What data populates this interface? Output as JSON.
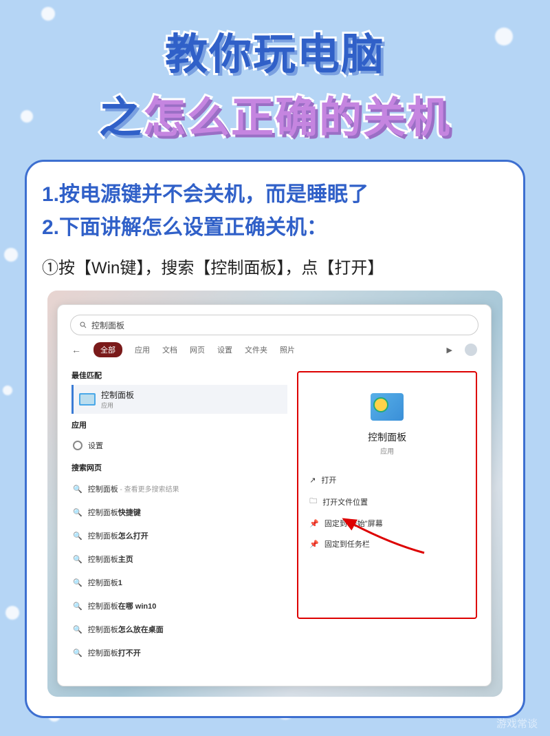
{
  "title": {
    "line1": "教你玩电脑",
    "zhi": "之",
    "pink": "怎么正确的关机"
  },
  "intro": {
    "line1": "1.按电源键并不会关机，而是睡眠了",
    "line2": "2.下面讲解怎么设置正确关机："
  },
  "step1": "①按【Win键】，搜索【控制面板】，点【打开】",
  "search": {
    "query": "控制面板",
    "tabs": {
      "all": "全部",
      "apps": "应用",
      "docs": "文档",
      "web": "网页",
      "settings": "设置",
      "folders": "文件夹",
      "photos": "照片"
    },
    "sections": {
      "bestmatch": "最佳匹配",
      "apps": "应用",
      "websearch": "搜索网页"
    },
    "bestmatch": {
      "title": "控制面板",
      "subtitle": "应用"
    },
    "appItem": "设置",
    "webItems": [
      {
        "q": "控制面板",
        "suffix": " - 查看更多搜索结果"
      },
      {
        "q": "控制面板",
        "bold": "快捷键"
      },
      {
        "q": "控制面板",
        "bold": "怎么打开"
      },
      {
        "q": "控制面板",
        "bold": "主页"
      },
      {
        "q": "控制面板",
        "bold": "1"
      },
      {
        "q": "控制面板",
        "bold": "在哪 win10"
      },
      {
        "q": "控制面板",
        "bold": "怎么放在桌面"
      },
      {
        "q": "控制面板",
        "bold": "打不开"
      }
    ],
    "detail": {
      "title": "控制面板",
      "subtitle": "应用",
      "actions": {
        "open": "打开",
        "openLocation": "打开文件位置",
        "pinStart": "固定到\"开始\"屏幕",
        "pinTaskbar": "固定到任务栏"
      }
    }
  },
  "watermark": "游戏常谈"
}
